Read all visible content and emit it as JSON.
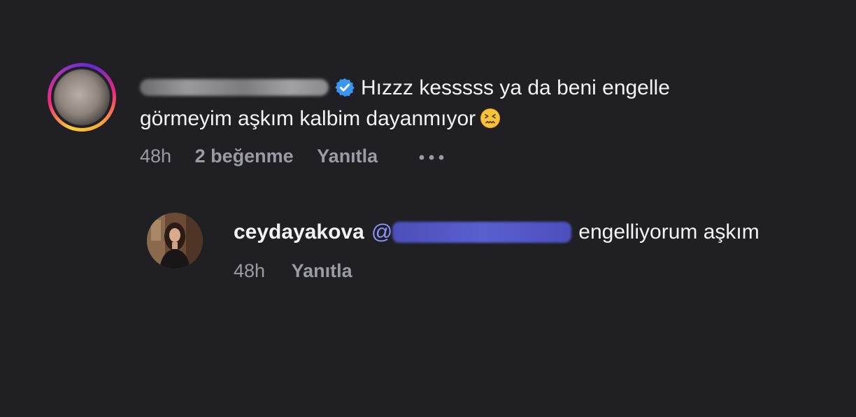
{
  "comment": {
    "text_line1": "Hızzz kesssss ya da beni engelle",
    "text_line2": "görmeyim aşkım kalbim dayanmıyor",
    "emoji": "confounded-face-emoji",
    "verified": true,
    "time": "48h",
    "likes": "2 beğenme",
    "reply_label": "Yanıtla",
    "more_icon": "ellipsis-icon"
  },
  "reply": {
    "username": "ceydayakova",
    "mention_prefix": "@",
    "text": "engelliyorum aşkım",
    "time": "48h",
    "reply_label": "Yanıtla"
  },
  "colors": {
    "background": "#1f1f24",
    "text": "#f3f3f3",
    "meta": "#9a9ca3",
    "mention": "#8f93ff",
    "verified": "#3897f0"
  }
}
